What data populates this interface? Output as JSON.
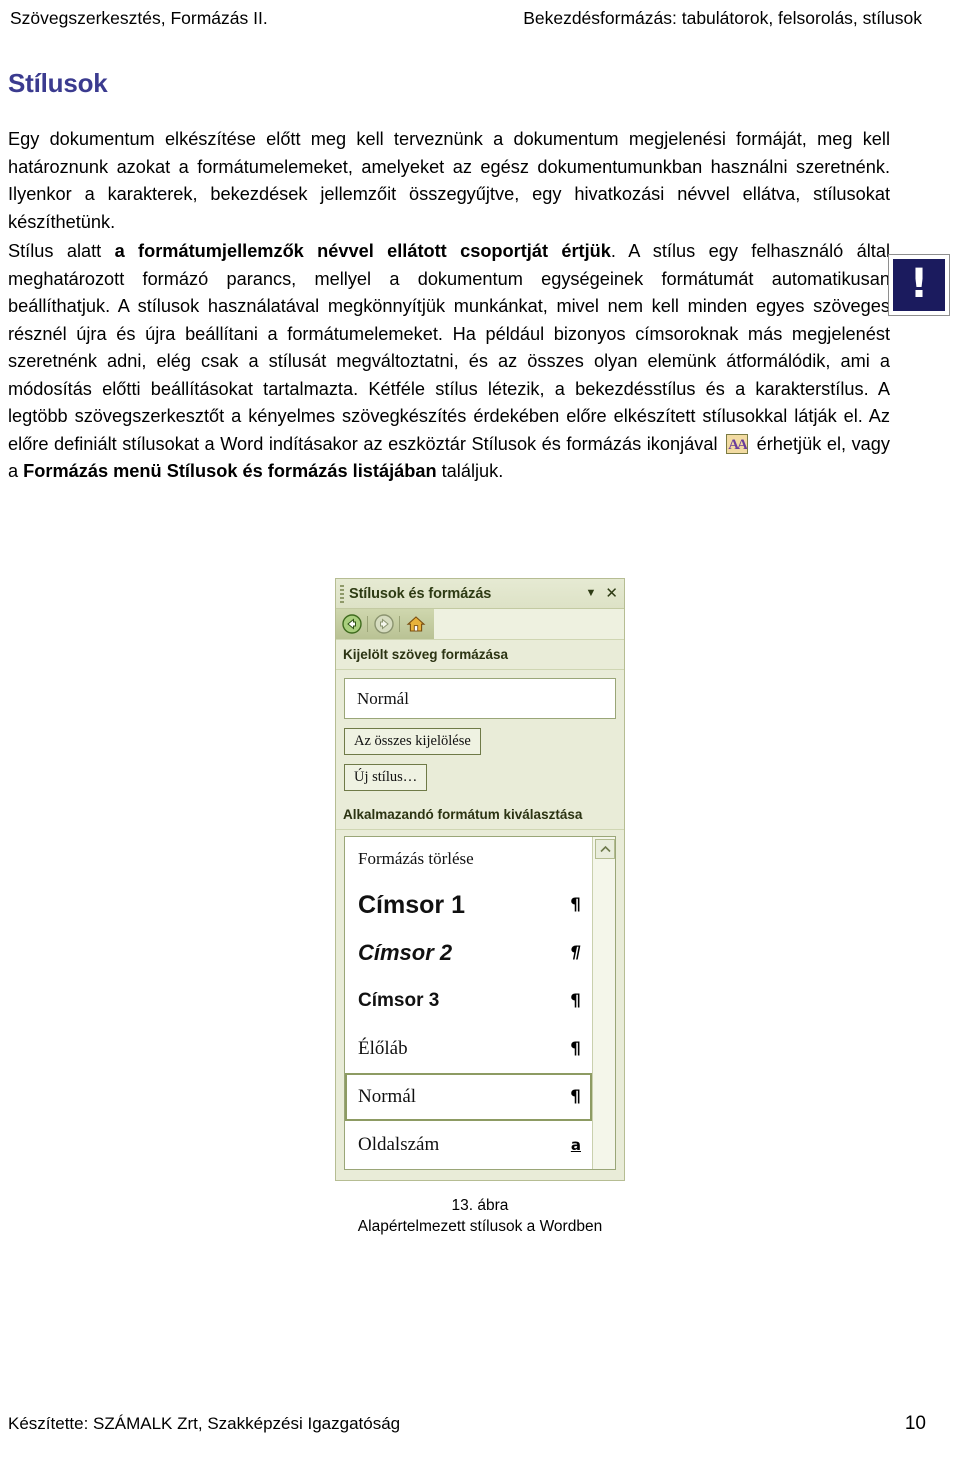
{
  "header": {
    "left": "Szövegszerkesztés, Formázás II.",
    "right": "Bekezdésformázás: tabulátorok, felsorolás, stílusok"
  },
  "title": "Stílusok",
  "paragraphs": {
    "p1": "Egy dokumentum elkészítése előtt meg kell terveznünk a dokumentum megjelenési formáját, meg kell határoznunk azokat a formátumelemeket, amelyeket az egész dokumentumunkban használni szeretnénk. Ilyenkor a karakterek, bekezdések jellemzőit összegyűjtve, egy hivatkozási névvel ellátva, stílusokat készíthetünk.",
    "p2_lead": "Stílus alatt ",
    "p2_bold": "a formátumjellemzők névvel ellátott csoportját értjük",
    "p2_rest": ". A stílus egy felhasználó által meghatározott formázó parancs, mellyel a dokumentum egységeinek formátumát automatikusan beállíthatjuk. A stílusok használatával megkönnyítjük munkánkat, mivel nem kell minden egyes szöveges résznél újra és újra beállítani a formátumelemeket. Ha például bizonyos címsoroknak más megjelenést szeretnénk adni, elég csak a stílusát megváltoztatni, és az összes olyan elemünk átformálódik, ami a módosítás előtti beállításokat tartalmazta. Kétféle stílus létezik, a bekezdésstílus és a karakterstílus. A legtöbb szövegszerkesztőt a kényelmes szövegkészítés érdekében előre elkészített stílusokkal látják el. Az előre definiált stílusokat a Word indításakor az eszköztár Stílusok és formázás ikonjával ",
    "p2_after_icon": " érhetjük el, vagy a ",
    "p2_bold2": "Formázás menü Stílusok és formázás listájában",
    "p2_tail": " találjuk."
  },
  "note_icon": {
    "glyph": "!",
    "background": "#1b1b5e"
  },
  "inline_icon": {
    "glyph": "AA",
    "background": "#f2dba2"
  },
  "taskpane": {
    "title": "Stílusok és formázás",
    "caret": "▼",
    "close": "✕",
    "nav": {
      "back": "◀",
      "forward": "▶",
      "home": "⌂"
    },
    "section_selected_label": "Kijelölt szöveg formázása",
    "preview_value": "Normál",
    "select_all_button": "Az összes kijelölése",
    "new_style_button": "Új stílus…",
    "section_apply_label": "Alkalmazandó formátum kiválasztása",
    "scroll_up": "︿",
    "styles": [
      {
        "label": "Formázás törlése",
        "mark": "",
        "kind": "clear",
        "selected": false
      },
      {
        "label": "Címsor 1",
        "mark": "¶",
        "kind": "h1",
        "selected": false
      },
      {
        "label": "Címsor 2",
        "mark": "¶",
        "kind": "h2",
        "selected": false
      },
      {
        "label": "Címsor 3",
        "mark": "¶",
        "kind": "h3",
        "selected": false
      },
      {
        "label": "Élőláb",
        "mark": "¶",
        "kind": "normal",
        "selected": false
      },
      {
        "label": "Normál",
        "mark": "¶",
        "kind": "normal",
        "selected": true
      },
      {
        "label": "Oldalszám",
        "mark": "a",
        "kind": "normal",
        "selected": false,
        "mark_char": true
      }
    ]
  },
  "figure": {
    "number": "13. ábra",
    "caption": "Alapértelmezett stílusok a Wordben"
  },
  "footer": {
    "left": "Készítette: SZÁMALK Zrt, Szakképzési Igazgatóság",
    "page": "10"
  }
}
